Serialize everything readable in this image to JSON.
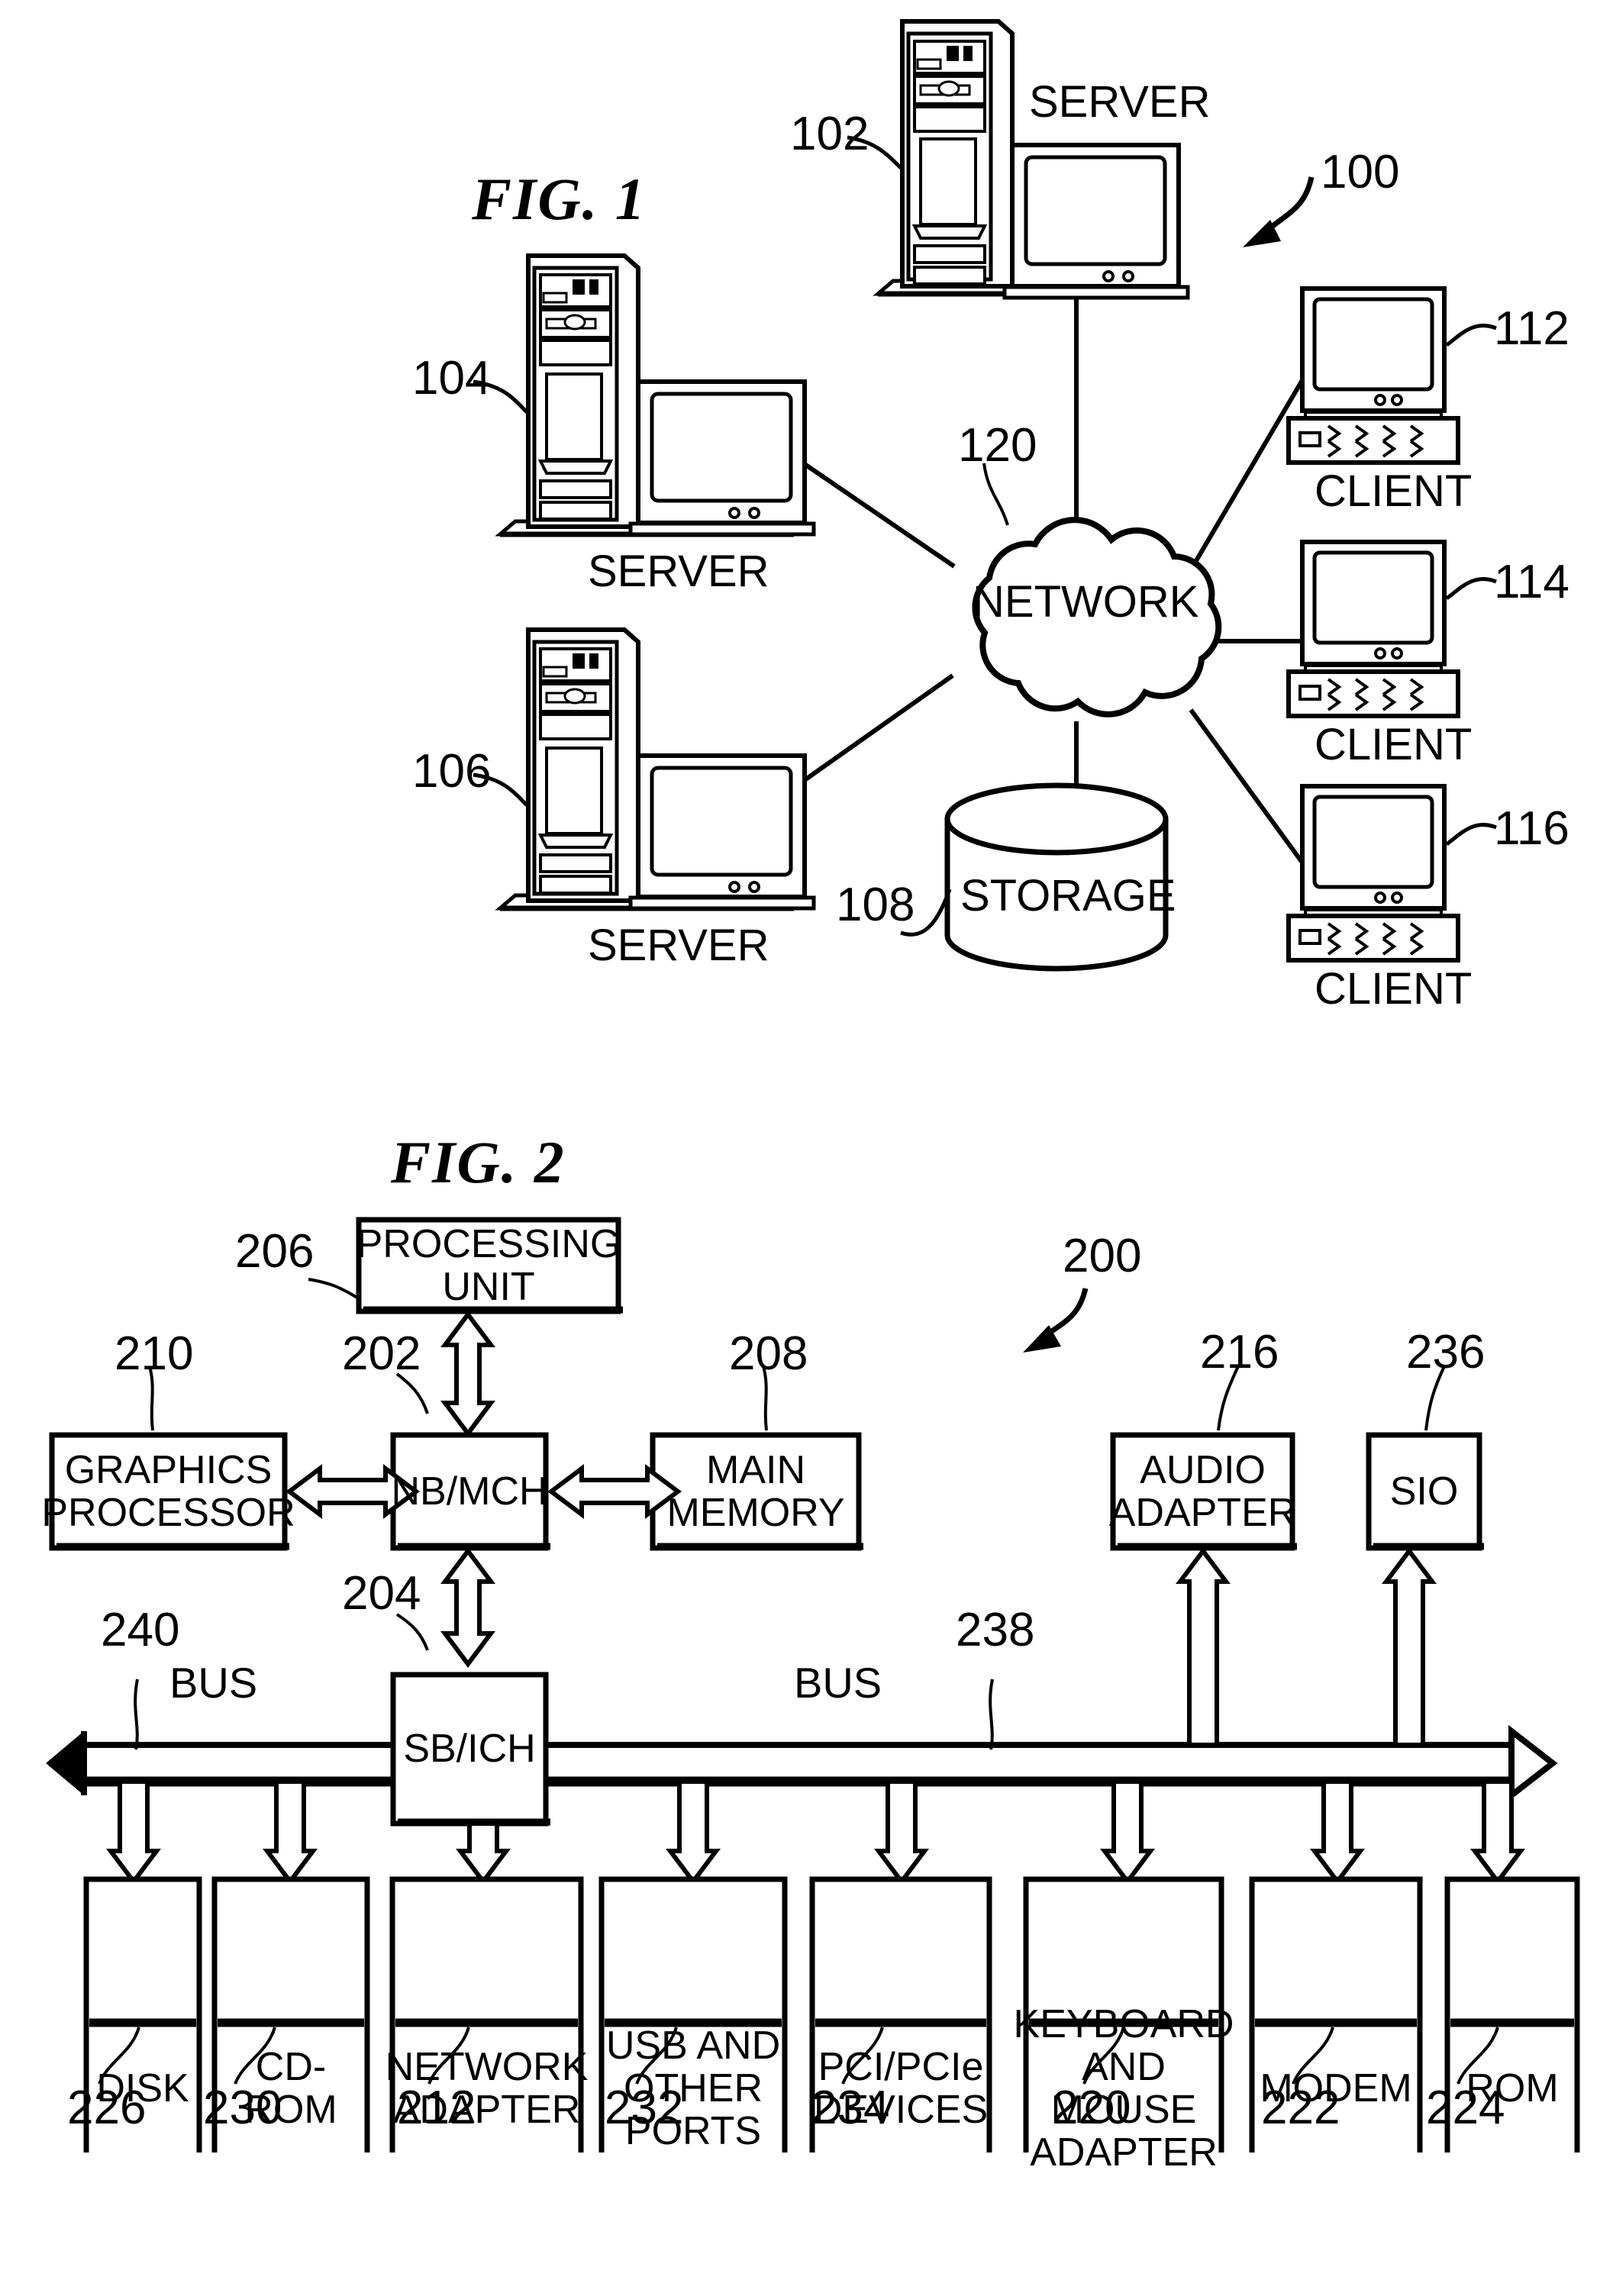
{
  "figures": [
    {
      "title": "FIG. 1",
      "system_ref": "100",
      "network_label": "NETWORK",
      "network_ref": "120",
      "storage_label": "STORAGE",
      "storage_ref": "108",
      "nodes": [
        {
          "kind": "server",
          "caption": "SERVER",
          "ref": "102"
        },
        {
          "kind": "server",
          "caption": "SERVER",
          "ref": "104"
        },
        {
          "kind": "server",
          "caption": "SERVER",
          "ref": "106"
        },
        {
          "kind": "client",
          "caption": "CLIENT",
          "ref": "112"
        },
        {
          "kind": "client",
          "caption": "CLIENT",
          "ref": "114"
        },
        {
          "kind": "client",
          "caption": "CLIENT",
          "ref": "116"
        }
      ]
    },
    {
      "title": "FIG. 2",
      "system_ref": "200",
      "bus_label_left": "BUS",
      "bus_label_right": "BUS",
      "bus_ref_left": "240",
      "bus_ref_right": "238",
      "blocks": [
        {
          "id": "processing-unit",
          "label": "PROCESSING UNIT",
          "ref": "206"
        },
        {
          "id": "nb-mch",
          "label": "NB/MCH",
          "ref": "202"
        },
        {
          "id": "graphics-processor",
          "label": "GRAPHICS PROCESSOR",
          "ref": "210"
        },
        {
          "id": "main-memory",
          "label": "MAIN MEMORY",
          "ref": "208"
        },
        {
          "id": "audio-adapter",
          "label": "AUDIO ADAPTER",
          "ref": "216"
        },
        {
          "id": "sio",
          "label": "SIO",
          "ref": "236"
        },
        {
          "id": "sb-ich",
          "label": "SB/ICH",
          "ref": "204"
        },
        {
          "id": "disk",
          "label": "DISK",
          "ref": "226"
        },
        {
          "id": "cd-rom",
          "label": "CD-ROM",
          "ref": "230"
        },
        {
          "id": "network-adapter",
          "label": "NETWORK ADAPTER",
          "ref": "212"
        },
        {
          "id": "usb-and-other-ports",
          "label": "USB AND OTHER PORTS",
          "ref": "232"
        },
        {
          "id": "pci-pcie-devices",
          "label": "PCI/PCIe DEVICES",
          "ref": "234"
        },
        {
          "id": "keyboard-and-mouse-adapter",
          "label": "KEYBOARD AND MOUSE ADAPTER",
          "ref": "220"
        },
        {
          "id": "modem",
          "label": "MODEM",
          "ref": "222"
        },
        {
          "id": "rom",
          "label": "ROM",
          "ref": "224"
        }
      ]
    }
  ],
  "fig1": {
    "title": "FIG. 1",
    "ref_100": "100",
    "ref_102": "102",
    "ref_104": "104",
    "ref_106": "106",
    "ref_108": "108",
    "ref_112": "112",
    "ref_114": "114",
    "ref_116": "116",
    "ref_120": "120",
    "server_top_caption": "SERVER",
    "server_mid_caption": "SERVER",
    "server_bot_caption": "SERVER",
    "client_1_caption": "CLIENT",
    "client_2_caption": "CLIENT",
    "client_3_caption": "CLIENT",
    "network_text": "NETWORK",
    "storage_text": "STORAGE"
  },
  "fig2": {
    "title": "FIG. 2",
    "ref_200": "200",
    "ref_202": "202",
    "ref_204": "204",
    "ref_206": "206",
    "ref_208": "208",
    "ref_210": "210",
    "ref_212": "212",
    "ref_216": "216",
    "ref_220": "220",
    "ref_222": "222",
    "ref_224": "224",
    "ref_226": "226",
    "ref_230": "230",
    "ref_232": "232",
    "ref_234": "234",
    "ref_236": "236",
    "ref_238": "238",
    "ref_240": "240",
    "bus_left": "BUS",
    "bus_right": "BUS",
    "processing_unit": "PROCESSING UNIT",
    "graphics_processor": "GRAPHICS PROCESSOR",
    "nb_mch": "NB/MCH",
    "main_memory": "MAIN MEMORY",
    "audio_adapter": "AUDIO ADAPTER",
    "sio": "SIO",
    "sb_ich": "SB/ICH",
    "disk": "DISK",
    "cd_rom": "CD-ROM",
    "network_adapter": "NETWORK ADAPTER",
    "usb_ports": "USB AND OTHER PORTS",
    "pci_pcie": "PCI/PCIe DEVICES",
    "kbd_mouse": "KEYBOARD AND MOUSE ADAPTER",
    "modem": "MODEM",
    "rom": "ROM"
  },
  "colors": {
    "ink": "#000000",
    "paper": "#ffffff"
  }
}
